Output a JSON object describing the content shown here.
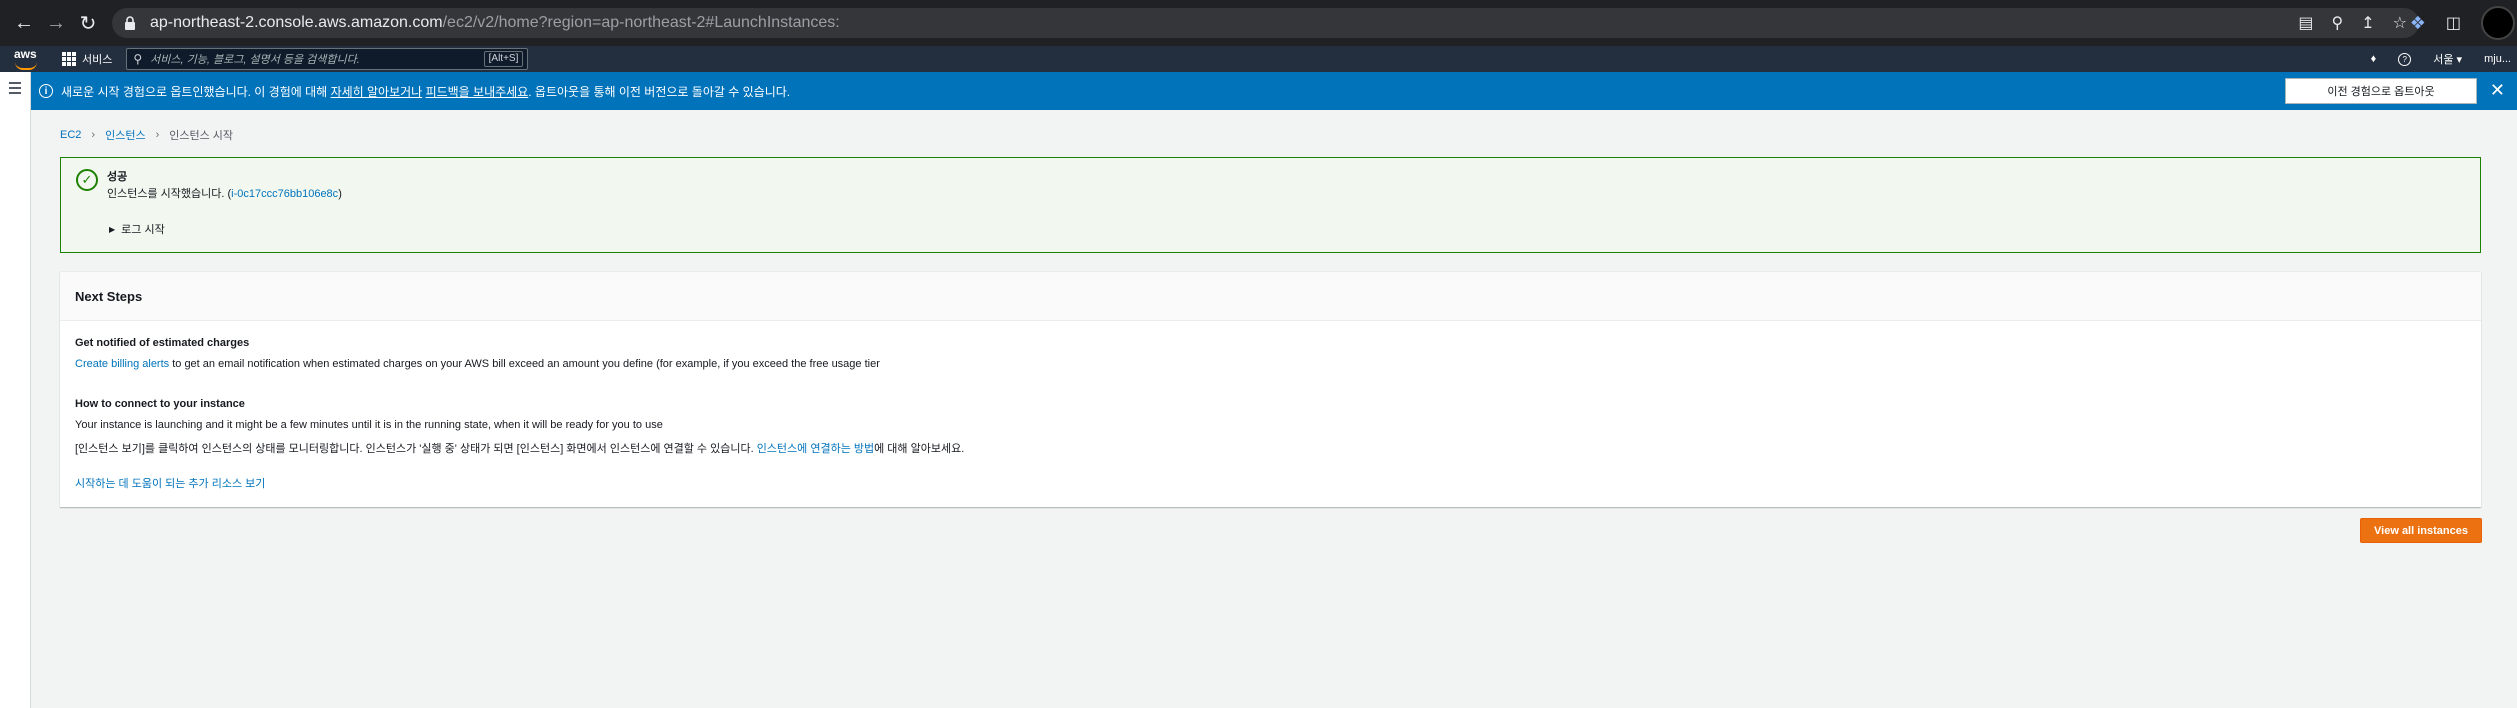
{
  "browser": {
    "url_host": "ap-northeast-2.console.aws.amazon.com",
    "url_path": "/ec2/v2/home?region=ap-northeast-2#LaunchInstances:"
  },
  "aws_nav": {
    "logo_text": "aws",
    "services_label": "서비스",
    "search_placeholder": "서비스, 기능, 블로그, 설명서 등을 검색합니다.",
    "search_shortcut": "[Alt+S]",
    "region_label": "서울 ▾",
    "account_label": "mju..."
  },
  "banner": {
    "msg_part1": "새로운 시작 경험으로 옵트인했습니다. 이 경험에 대해 ",
    "msg_link1": "자세히 알아보거나",
    "msg_part2": " ",
    "msg_link2": "피드백을 보내주세요",
    "msg_part3": ". 옵트아웃을 통해 이전 버전으로 돌아갈 수 있습니다.",
    "opt_out_button": "이전 경험으로 옵트아웃",
    "accent_color": "#0073bb"
  },
  "breadcrumb": {
    "ec2": "EC2",
    "instances": "인스턴스",
    "current": "인스턴스 시작"
  },
  "success_alert": {
    "title": "성공",
    "desc_prefix": "인스턴스를 시작했습니다. (",
    "instance_id": "i-0c17ccc76bb106e8c",
    "desc_suffix": ")",
    "log_toggle": "로그 시작",
    "color": "#1d8102"
  },
  "next_steps": {
    "title": "Next Steps",
    "billing_heading": "Get notified of estimated charges",
    "billing_link": "Create billing alerts",
    "billing_text": " to get an email notification when estimated charges on your AWS bill exceed an amount you define (for example, if you exceed the free usage tier",
    "connect_heading": "How to connect to your instance",
    "connect_text": "Your instance is launching and it might be a few minutes until it is in the running state, when it will be ready for you to use",
    "monitor_text": "[인스턴스 보기]를 클릭하여 인스턴스의 상태를 모니터링합니다. 인스턴스가 '실행 중' 상태가 되면 [인스턴스] 화면에서 인스턴스에 연결할 수 있습니다. ",
    "monitor_link": "인스턴스에 연결하는 방법",
    "monitor_suffix": "에 대해 알아보세요.",
    "resources_link": "시작하는 데 도움이 되는 추가 리소스 보기"
  },
  "view_all_button": "View all instances",
  "button_color": "#ec7211"
}
